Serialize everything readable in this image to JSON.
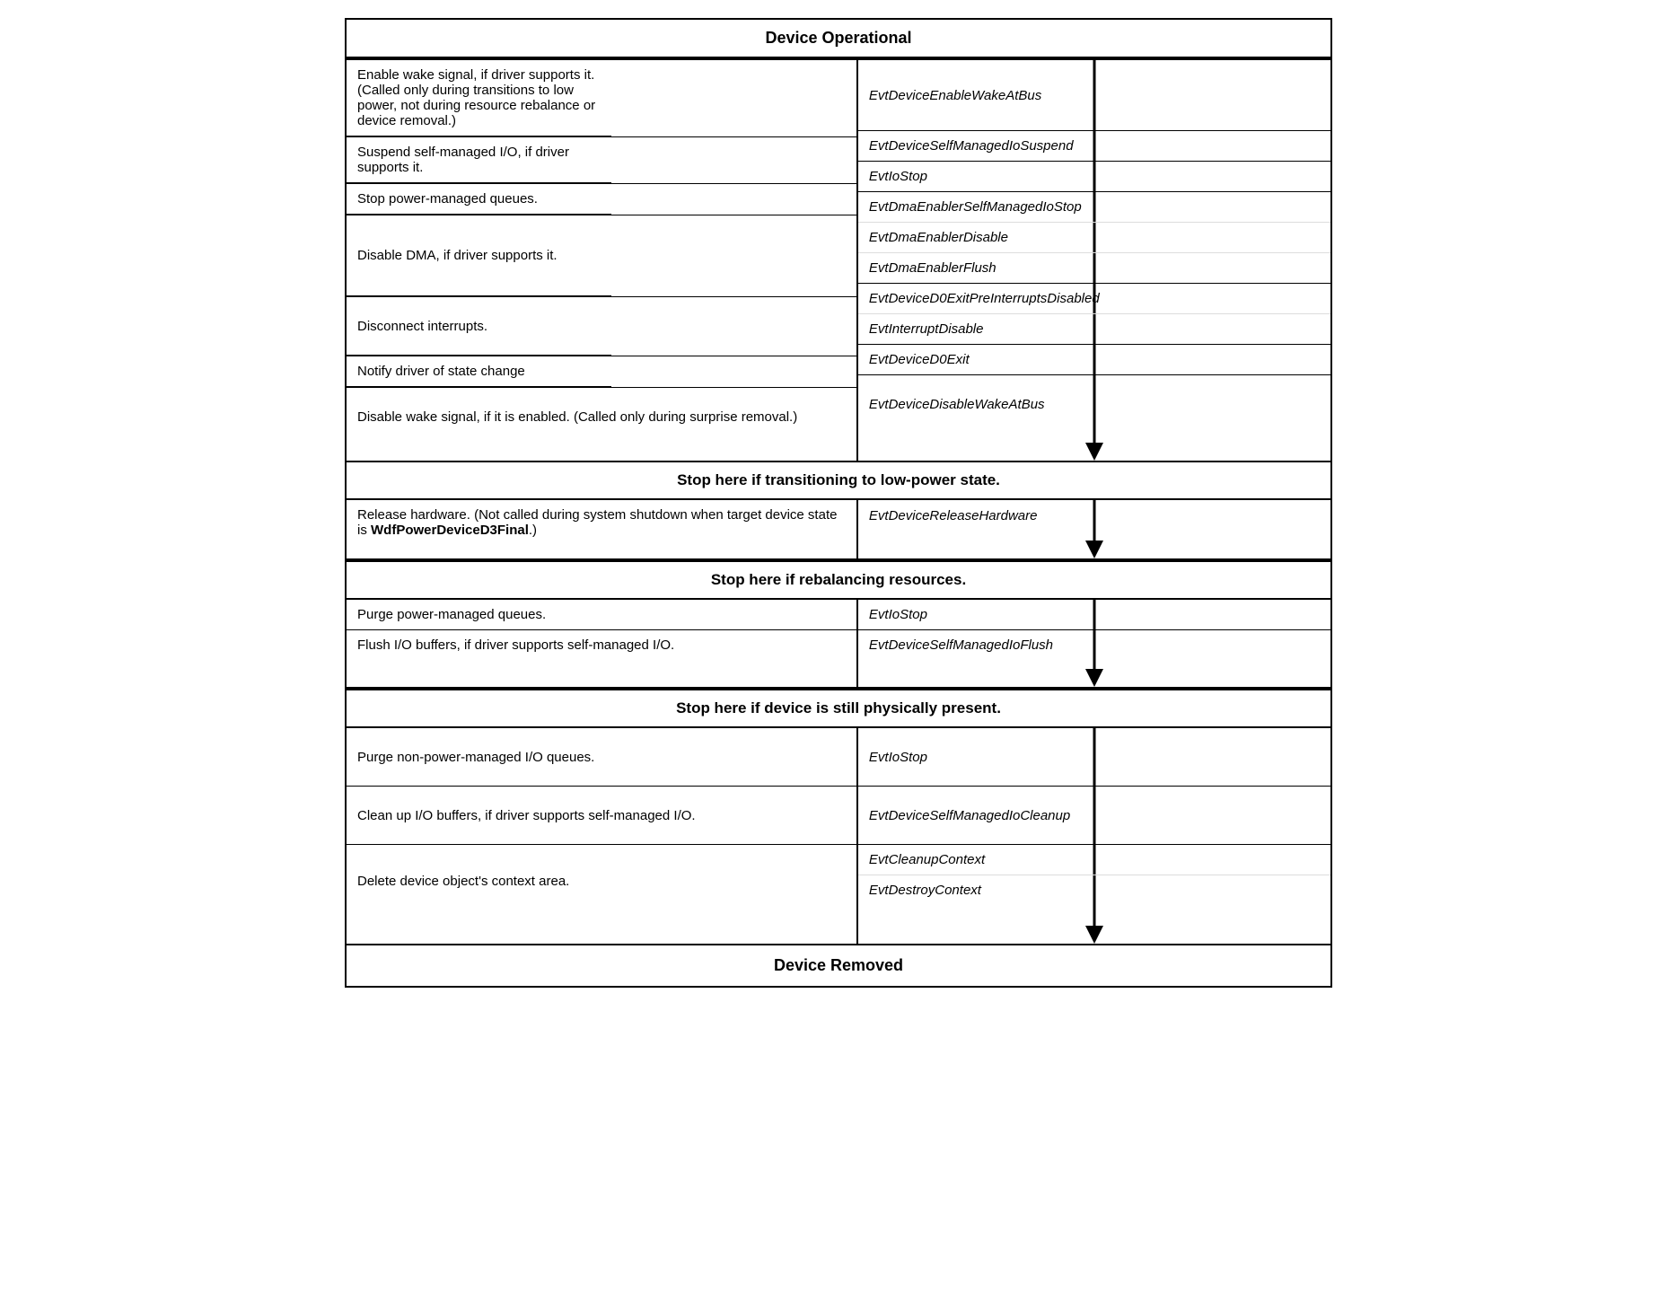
{
  "title": "Device Operational",
  "bottomLabel": "Device Removed",
  "sections": {
    "header": "Device Operational",
    "stopLowPower": "Stop here if transitioning to low-power state.",
    "stopRebalancing": "Stop here if rebalancing resources.",
    "stopPhysicallyPresent": "Stop here if device is still physically present."
  },
  "rows": {
    "group1": [
      {
        "left": "Enable wake signal, if driver supports it. (Called only during transitions to low power, not during resource rebalance or device removal.)",
        "right": "EvtDeviceEnableWakeAtBus"
      },
      {
        "left": "Suspend self-managed I/O, if driver supports it.",
        "right": "EvtDeviceSelfManagedIoSuspend"
      },
      {
        "left": "Stop power-managed queues.",
        "right": "EvtIoStop"
      },
      {
        "left": "Disable DMA, if driver supports it.",
        "rightMulti": [
          "EvtDmaEnablerSelfManagedIoStop",
          "EvtDmaEnablerDisable",
          "EvtDmaEnablerFlush"
        ]
      },
      {
        "left": "Disconnect interrupts.",
        "rightMulti": [
          "EvtDeviceD0ExitPreInterruptsDisabled",
          "EvtInterruptDisable"
        ]
      },
      {
        "left": "Notify driver of state change",
        "right": "EvtDeviceD0Exit"
      },
      {
        "left": "Disable wake signal, if it is enabled. (Called only during surprise removal.)",
        "right": "EvtDeviceDisableWakeAtBus"
      }
    ],
    "group2": [
      {
        "left": "Release hardware. (Not called during system shutdown when target device state is WdfPowerDeviceD3Final.)",
        "leftBold": "WdfPowerDeviceD3Final",
        "right": "EvtDeviceReleaseHardware"
      }
    ],
    "group3": [
      {
        "left": "Purge power-managed queues.",
        "right": "EvtIoStop"
      },
      {
        "left": "Flush I/O buffers, if driver supports self-managed I/O.",
        "right": "EvtDeviceSelfManagedIoFlush"
      }
    ],
    "group4": [
      {
        "left": "Purge non-power-managed I/O queues.",
        "right": "EvtIoStop"
      },
      {
        "left": "Clean up I/O buffers, if driver supports self-managed I/O.",
        "right": "EvtDeviceSelfManagedIoCleanup"
      },
      {
        "left": "Delete device object's context area.",
        "rightMulti": [
          "EvtCleanupContext",
          "EvtDestroyContext"
        ]
      }
    ]
  }
}
